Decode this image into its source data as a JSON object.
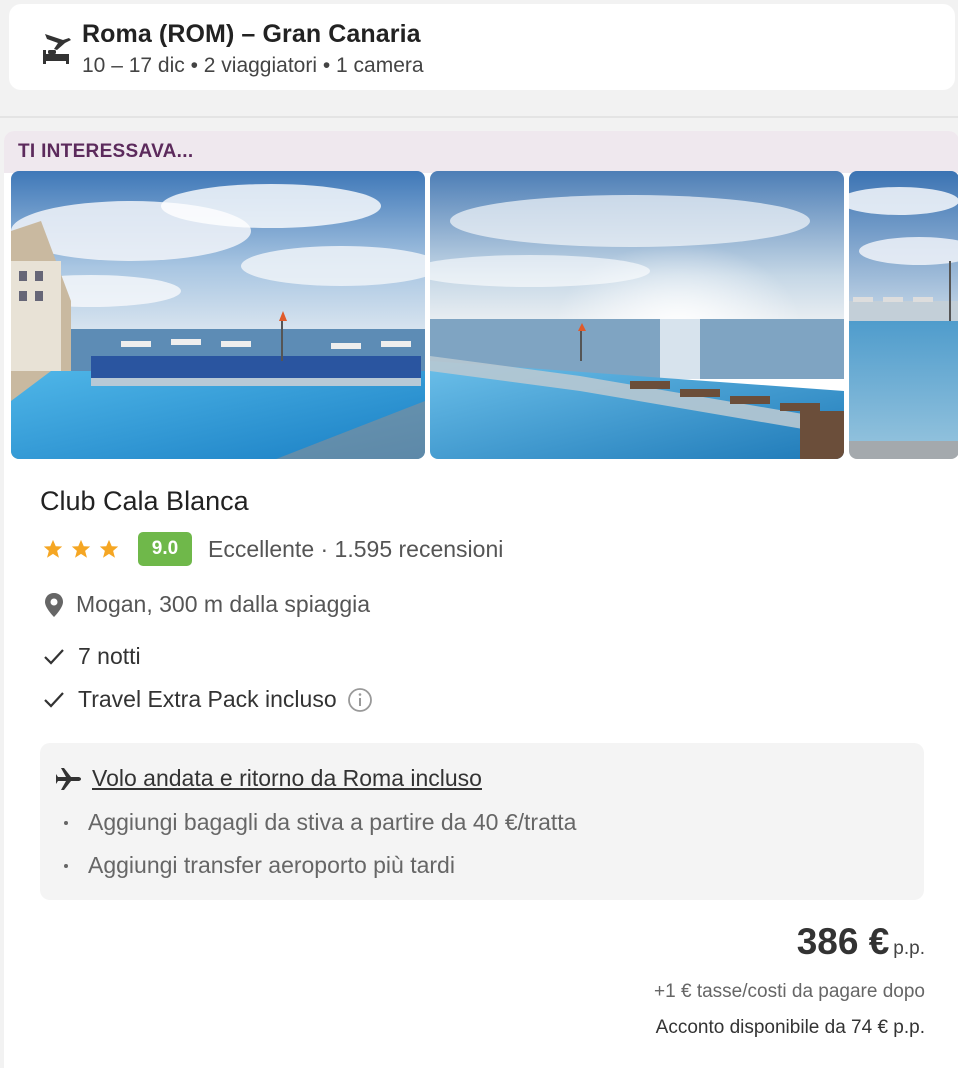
{
  "search_summary": {
    "icon": "flight-hotel-icon",
    "title": "Roma (ROM) – Gran Canaria",
    "subtitle": "10 – 17 dic • 2 viaggiatori • 1 camera"
  },
  "card": {
    "header_label": "TI INTERESSAVA...",
    "gallery": [
      {
        "icon": "hotel-photo-pool-1"
      },
      {
        "icon": "hotel-photo-pool-sunset"
      },
      {
        "icon": "hotel-photo-pool-3"
      }
    ],
    "hotel_name": "Club Cala Blanca",
    "stars": 3,
    "score": "9.0",
    "rating_text": "Eccellente · 1.595 recensioni",
    "location": "Mogan, 300 m dalla spiaggia",
    "features": [
      "7 notti",
      "Travel Extra Pack incluso"
    ],
    "flight": {
      "title": "Volo andata e ritorno da Roma incluso",
      "bullets": [
        "Aggiungi bagagli da stiva a partire da 40 €/tratta",
        "Aggiungi transfer aeroporto più tardi"
      ]
    },
    "price": {
      "value": "386 €",
      "unit": "p.p.",
      "taxes": "+1 € tasse/costi da pagare dopo",
      "deposit": "Acconto disponibile da 74 € p.p."
    },
    "colors": {
      "accent": "#5c2a5c",
      "score_badge": "#6fb84a",
      "star": "#f5a623"
    }
  }
}
